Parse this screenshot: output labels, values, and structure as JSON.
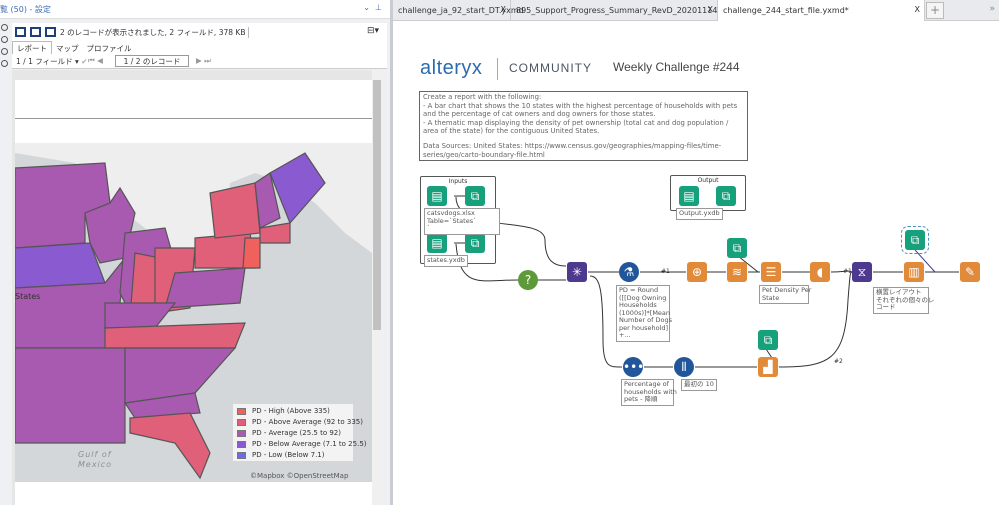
{
  "left_panel": {
    "header_title": "覧 (50) - 設定",
    "header_icons": [
      "chevron-down-icon",
      "pin-icon"
    ],
    "record_info": "2 のレコードが表示されました, 2 フィールド, 378 KB",
    "tabs": [
      {
        "label": "レポート",
        "active": true
      },
      {
        "label": "マップ",
        "active": false
      },
      {
        "label": "プロファイル",
        "active": false
      }
    ],
    "field_select": "1 / 1 フィールド",
    "record_position": "1 / 2 のレコード",
    "map": {
      "legend": [
        {
          "label": "PD - High (Above 335)",
          "color": "#f0615e"
        },
        {
          "label": "PD - Above Average (92 to 335)",
          "color": "#e0607a"
        },
        {
          "label": "PD - Average (25.5 to 92)",
          "color": "#a85ab0"
        },
        {
          "label": "PD - Below Average (7.1 to 25.5)",
          "color": "#8a5ad0"
        },
        {
          "label": "PD - Low (Below 7.1)",
          "color": "#6a6af0"
        }
      ],
      "place_labels": {
        "gulf": "Gulf of",
        "mexico": "Mexico",
        "states": "States"
      },
      "attribution": "©Mapbox ©OpenStreetMap"
    }
  },
  "tabs": [
    {
      "label": "challenge_ja_92_start_DT.yxmd",
      "active": false
    },
    {
      "label": "895_Support_Progress_Summary_RevD_20201114.yxmd*",
      "active": false
    },
    {
      "label": "challenge_244_start_file.yxmd*",
      "active": true
    }
  ],
  "tab_close": "X",
  "tab_add": "+",
  "tab_more": "»",
  "canvas": {
    "logo": "alteryx",
    "community": "COMMUNITY",
    "challenge_title": "Weekly Challenge #244",
    "description": [
      "Create a report with the following:",
      "- A bar chart that shows the 10 states with the highest percentage of households with pets and the percentage of cat owners and dog owners for those states.",
      "- A thematic map displaying the density  of pet ownership (total cat and dog population / area of the state) for the contiguous United States.",
      "",
      "Data Sources: United States: https://www.census.gov/geographies/mapping-files/time-series/geo/carto-boundary-file.html"
    ],
    "inputs_container": "Inputs",
    "output_container": "Output",
    "labels": {
      "catsvdogs": "catsvdogs.xlsx\nTable=`States`\n`",
      "states": "states.yxdb",
      "output": "Output.yxdb",
      "formula": "PD = Round\n([[Dog Owning\nHouseholds\n(1000s)]*[Mean\nNumber of Dogs\nper household]\n+...",
      "pet_density": "Pet Density Per\nState",
      "percentage": "Percentage of\nhouseholds with\npets - 降順",
      "top10": "最初の 10",
      "layout": "横置レイアウト\nそれぞれの個々のレ\nコード"
    },
    "connection_labels": {
      "a": "#1",
      "b": "#1",
      "c": "#1",
      "d": "#2"
    }
  }
}
